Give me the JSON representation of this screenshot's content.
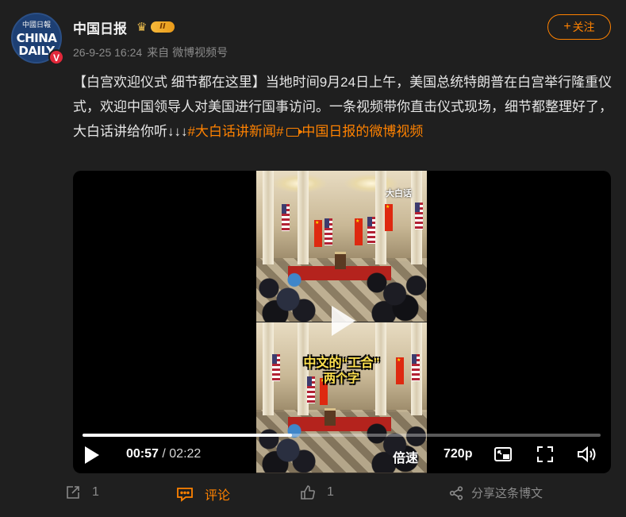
{
  "author": {
    "name": "中国日报",
    "avatar_brush_text": "中國日報",
    "avatar_line1": "CHINA",
    "avatar_line2": "DAILY",
    "verified_mark": "V",
    "level_label": "II"
  },
  "meta": {
    "timestamp": "26-9-25 16:24",
    "source_prefix": "来自",
    "source": "微博视频号"
  },
  "follow": {
    "plus": "+",
    "label": "关注"
  },
  "post": {
    "text_main": "【白宫欢迎仪式 细节都在这里】当地时间9月24日上午，美国总统特朗普在白宫举行隆重仪式，欢迎中国领导人对美国进行国事访问。一条视频带你直击仪式现场，细节都整理好了，大白话讲给你听↓↓↓",
    "hashtag": "#大白话讲新闻#",
    "source_link": "中国日报的微博视频"
  },
  "video": {
    "watermark": "大白话",
    "subtitle_line1": "中文的“工合”",
    "subtitle_line2": "两个字",
    "progress": 0.405,
    "current_time": "00:57",
    "separator": "/",
    "total_time": "02:22",
    "speed_label": "倍速",
    "quality_label": "720p"
  },
  "actions": {
    "repost_count": "1",
    "comment_label": "评论",
    "like_count": "1",
    "share_label": "分享这条博文"
  },
  "colors": {
    "accent": "#ff8200",
    "background": "#1f1f1f",
    "verified_red": "#e2283a"
  },
  "icons": [
    "repost-icon",
    "comment-icon",
    "like-icon",
    "share-icon",
    "play-icon",
    "pip-icon",
    "fullscreen-icon",
    "volume-icon",
    "crown-icon",
    "video-icon"
  ]
}
